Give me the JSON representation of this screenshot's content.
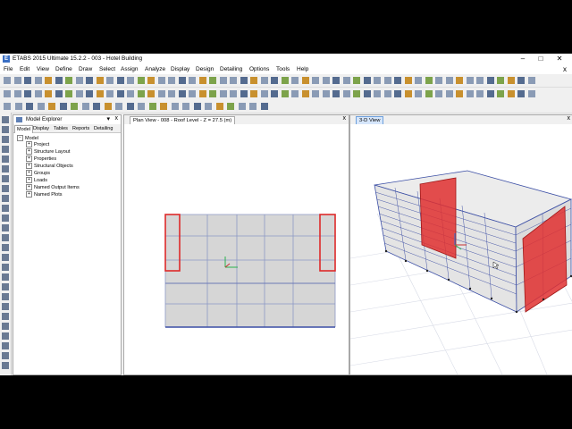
{
  "app": {
    "title": "ETABS 2015 Ultimate 15.2.2 - 003 - Hotel Building",
    "logo": "E",
    "minimize": "–",
    "maximize": "□",
    "close": "✕"
  },
  "menu": [
    "File",
    "Edit",
    "View",
    "Define",
    "Draw",
    "Select",
    "Assign",
    "Analyze",
    "Display",
    "Design",
    "Detailing",
    "Options",
    "Tools",
    "Help"
  ],
  "menu_close": "x",
  "model_explorer": {
    "title": "Model Explorer",
    "pin": "▾",
    "close": "x",
    "tabs": [
      "Model",
      "Display",
      "Tables",
      "Reports",
      "Detailing"
    ],
    "root": "Model",
    "items": [
      "Project",
      "Structure Layout",
      "Properties",
      "Structural Objects",
      "Groups",
      "Loads",
      "Named Output Items",
      "Named Plots"
    ]
  },
  "plan_view": {
    "title": "Plan View - 008 - Roof Level - Z = 27.5 (m)",
    "close": "x"
  },
  "view_3d": {
    "title": "3-D View",
    "close": "x"
  },
  "colors": {
    "slab": "#d6d6d6",
    "grid_line": "#3c4fa5",
    "shear_wall": "#dd2a2a",
    "tab_active": "#d6e6fb"
  },
  "icons": [
    "select-pointer-icon",
    "save-icon",
    "undo-icon",
    "redo-icon",
    "zoom-icon",
    "pan-icon",
    "3d-view-icon",
    "draw-frame-icon",
    "draw-area-icon"
  ]
}
